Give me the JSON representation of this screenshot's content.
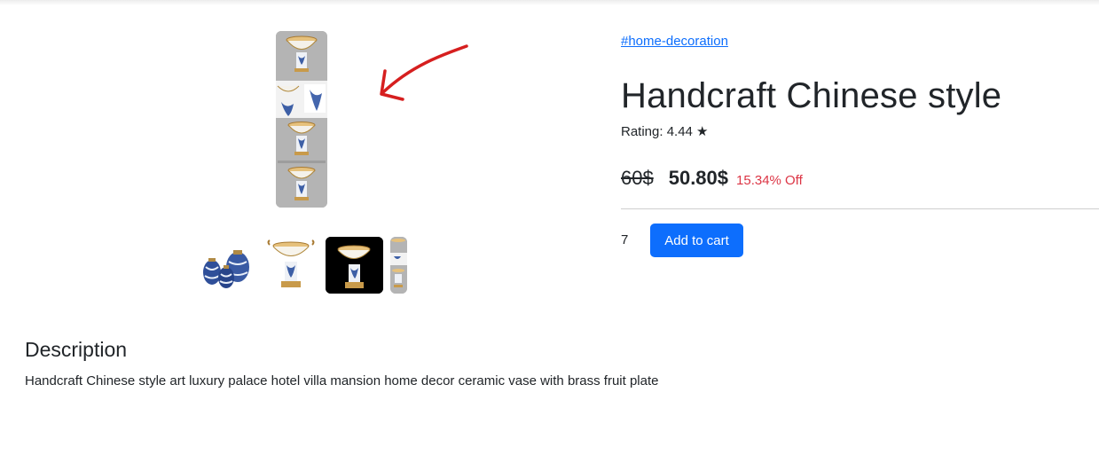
{
  "product": {
    "category": "#home-decoration",
    "title": "Handcraft Chinese style",
    "rating_text": "Rating: 4.44 ★",
    "old_price": "60$",
    "new_price": "50.80$",
    "discount": "15.34% Off",
    "quantity": "7",
    "add_to_cart_label": "Add to cart"
  },
  "description": {
    "heading": "Description",
    "text": "Handcraft Chinese style art luxury palace hotel villa mansion home decor ceramic vase with brass fruit plate"
  },
  "gallery": {
    "selected_index": 2,
    "thumbnail_count": 4
  },
  "colors": {
    "link": "#0d6efd",
    "button": "#0d6efd",
    "discount": "#dc3545",
    "annotation_arrow": "#d61f1f"
  },
  "icons": [
    "annotation-arrow-icon",
    "star-icon"
  ]
}
